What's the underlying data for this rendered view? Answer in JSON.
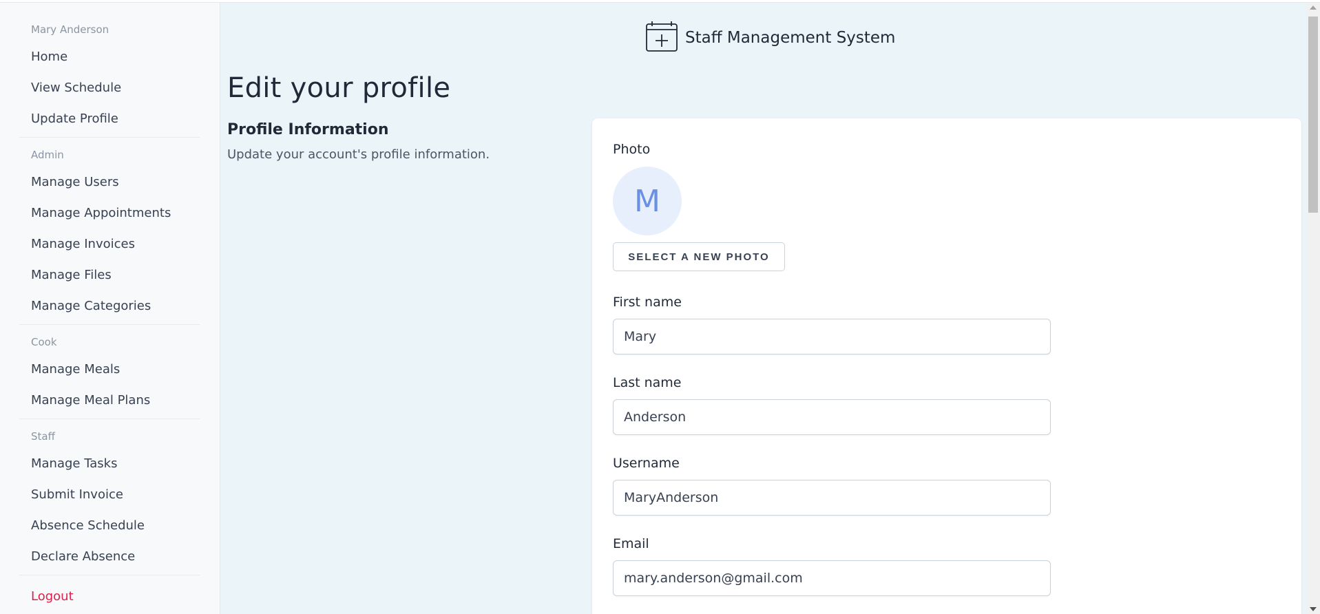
{
  "sidebar": {
    "user_name": "Mary Anderson",
    "user_items": [
      {
        "label": "Home"
      },
      {
        "label": "View Schedule"
      },
      {
        "label": "Update Profile"
      }
    ],
    "admin_title": "Admin",
    "admin_items": [
      {
        "label": "Manage Users"
      },
      {
        "label": "Manage Appointments"
      },
      {
        "label": "Manage Invoices"
      },
      {
        "label": "Manage Files"
      },
      {
        "label": "Manage Categories"
      }
    ],
    "cook_title": "Cook",
    "cook_items": [
      {
        "label": "Manage Meals"
      },
      {
        "label": "Manage Meal Plans"
      }
    ],
    "staff_title": "Staff",
    "staff_items": [
      {
        "label": "Manage Tasks"
      },
      {
        "label": "Submit Invoice"
      },
      {
        "label": "Absence Schedule"
      },
      {
        "label": "Declare Absence"
      }
    ],
    "logout_label": "Logout",
    "logout_color": "#e11d48"
  },
  "header": {
    "app_title": "Staff Management System",
    "logo_icon": "calendar-plus-icon"
  },
  "page": {
    "title": "Edit your profile",
    "section_heading": "Profile Information",
    "section_description": "Update your account's profile information."
  },
  "form": {
    "photo_label": "Photo",
    "avatar_initial": "M",
    "select_photo_label": "SELECT A NEW PHOTO",
    "first_name_label": "First name",
    "first_name_value": "Mary",
    "last_name_label": "Last name",
    "last_name_value": "Anderson",
    "username_label": "Username",
    "username_value": "MaryAnderson",
    "email_label": "Email",
    "email_value": "mary.anderson@gmail.com"
  },
  "colors": {
    "main_background": "#eaf4f9",
    "sidebar_background": "#f7f9fb",
    "avatar_background": "#e7effc",
    "avatar_text": "#6a8fe3"
  }
}
